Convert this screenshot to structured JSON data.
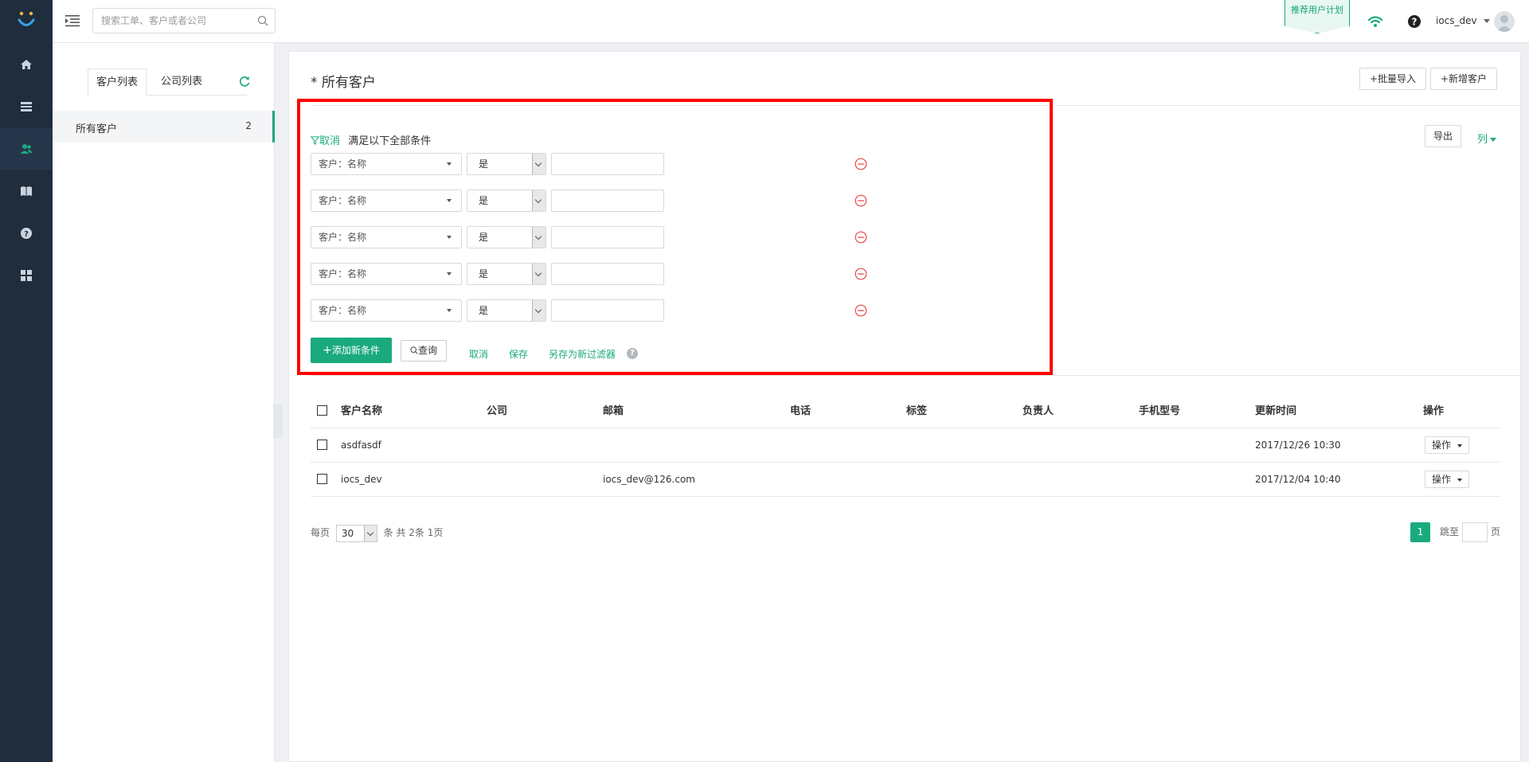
{
  "header": {
    "search_placeholder": "搜索工单、客户或者公司",
    "recommend_badge": "推荐用户计划",
    "user_name": "iocs_dev"
  },
  "nav": {
    "items": [
      "home-icon",
      "ticket-list-icon",
      "customers-icon",
      "knowledge-book-icon",
      "help-icon",
      "apps-grid-icon"
    ],
    "active_index": 2
  },
  "sidebar": {
    "tabs": [
      "客户列表",
      "公司列表"
    ],
    "active_tab": 0,
    "items": [
      {
        "label": "所有客户",
        "count": "2"
      }
    ]
  },
  "page": {
    "title": "* 所有客户",
    "bulk_import_label": "批量导入",
    "add_customer_label": "新增客户",
    "export_label": "导出",
    "columns_label": "列"
  },
  "filter": {
    "cancel_label": "取消",
    "description": "满足以下全部条件",
    "rows": [
      {
        "field": "客户：名称",
        "operator": "是",
        "value": ""
      },
      {
        "field": "客户：名称",
        "operator": "是",
        "value": ""
      },
      {
        "field": "客户：名称",
        "operator": "是",
        "value": ""
      },
      {
        "field": "客户：名称",
        "operator": "是",
        "value": ""
      },
      {
        "field": "客户：名称",
        "operator": "是",
        "value": ""
      }
    ],
    "add_condition_label": "添加新条件",
    "query_label": "查询",
    "cancel_link": "取消",
    "save_link": "保存",
    "save_as_link": "另存为新过滤器",
    "help_symbol": "?"
  },
  "table": {
    "columns": [
      "客户名称",
      "公司",
      "邮箱",
      "电话",
      "标签",
      "负责人",
      "手机型号",
      "更新时间",
      "操作"
    ],
    "rows": [
      {
        "name": "asdfasdf",
        "company": "",
        "email": "",
        "phone": "",
        "tags": "",
        "owner": "",
        "device": "",
        "updated": "2017/12/26 10:30",
        "action": "操作"
      },
      {
        "name": "iocs_dev",
        "company": "",
        "email": "iocs_dev@126.com",
        "phone": "",
        "tags": "",
        "owner": "",
        "device": "",
        "updated": "2017/12/04 10:40",
        "action": "操作"
      }
    ]
  },
  "pagination": {
    "per_page_prefix": "每页",
    "page_size": "30",
    "summary": "条 共 2条 1页",
    "current_page": "1",
    "jump_prefix": "跳至",
    "jump_suffix": "页"
  },
  "colors": {
    "accent": "#1aaa7e",
    "nav_bg": "#1f2d3d",
    "highlight_border": "#ff0000",
    "remove_icon": "#e84a4a"
  }
}
